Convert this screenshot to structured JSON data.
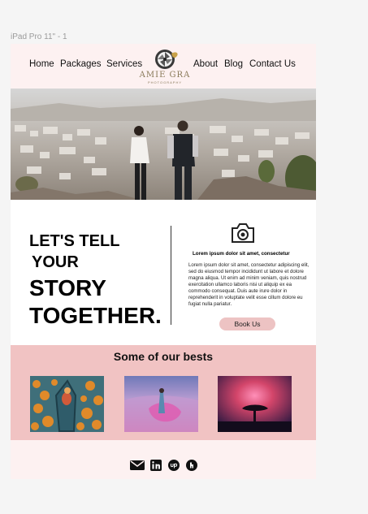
{
  "frame_label": "iPad Pro 11\" - 1",
  "nav": {
    "links": [
      {
        "label": "Home"
      },
      {
        "label": "Packages"
      },
      {
        "label": "Services"
      },
      {
        "label": "About"
      },
      {
        "label": "Blog"
      },
      {
        "label": "Contact Us"
      }
    ],
    "logo_text": "AMIE GRA",
    "logo_sub": "PHOTOGRAPHY"
  },
  "story": {
    "headline": [
      "LET'S  TELL",
      "YOUR",
      "STORY",
      "TOGETHER."
    ],
    "subtitle": "Lorem ipsum dolor sit amet, consectetur",
    "body": "Lorem ipsum dolor sit amet, consectetur adipiscing elit, sed do eiusmod tempor incididunt ut labore et dolore magna aliqua. Ut enim ad minim veniam, quis nostrud exercitation ullamco laboris nisi ut aliquip ex ea commodo consequat. Duis aute irure dolor in reprehenderit in voluptate velit esse cillum dolore eu fugiat nulla pariatur.",
    "button": "Book Us"
  },
  "bests": {
    "title": "Some of our bests"
  },
  "footer": {
    "icons": [
      "email-icon",
      "linkedin-icon",
      "upwork-icon",
      "houzz-icon"
    ]
  },
  "colors": {
    "nav_bg": "#fdf1f1",
    "accent_pink": "#f1c3c3",
    "button_pink": "#edc3c3"
  }
}
